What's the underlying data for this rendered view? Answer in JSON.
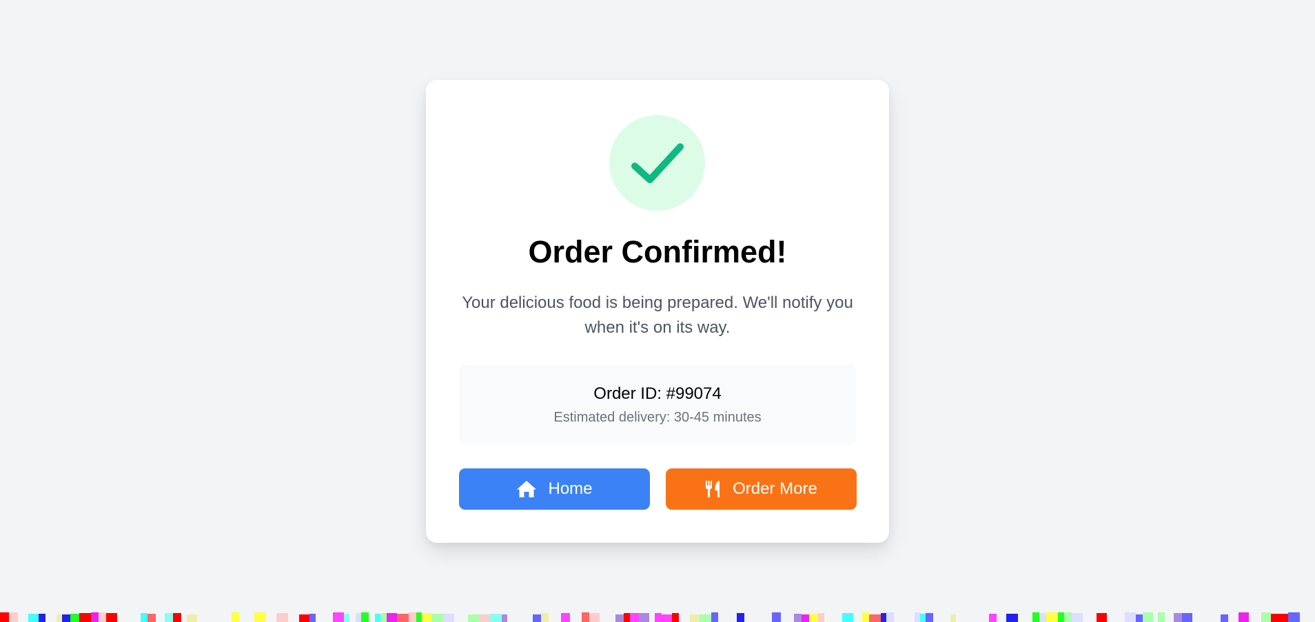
{
  "colors": {
    "page_bg": "#f3f4f6",
    "card_bg": "#ffffff",
    "success_green": "#10b981",
    "success_green_light": "#dcfce7",
    "home_blue": "#3b82f6",
    "order_more_orange": "#f97316"
  },
  "confirmation": {
    "icon": "check-icon",
    "title": "Order Confirmed!",
    "message": "Your delicious food is being prepared. We'll notify you when it's on its way."
  },
  "order": {
    "id_text": "Order ID: #99074",
    "eta_text": "Estimated delivery: 30-45 minutes"
  },
  "actions": {
    "home": {
      "label": "Home",
      "icon": "home-icon"
    },
    "order_more": {
      "label": "Order More",
      "icon": "utensils-icon"
    }
  }
}
